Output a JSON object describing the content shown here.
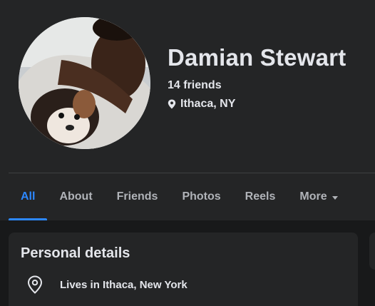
{
  "profile": {
    "name": "Damian Stewart",
    "friends": "14 friends",
    "location": "Ithaca, NY"
  },
  "tabs": [
    {
      "label": "All",
      "active": true
    },
    {
      "label": "About"
    },
    {
      "label": "Friends"
    },
    {
      "label": "Photos"
    },
    {
      "label": "Reels"
    },
    {
      "label": "More",
      "icon": "caret-down-icon"
    }
  ],
  "personal_details": {
    "title": "Personal details",
    "items": [
      {
        "icon": "location-pin-icon",
        "text": "Lives in Ithaca, New York"
      }
    ]
  },
  "colors": {
    "accent": "#2d88ff",
    "background": "#18191a",
    "surface": "#242526",
    "text_primary": "#e4e6eb",
    "text_secondary": "#b0b3b8"
  }
}
